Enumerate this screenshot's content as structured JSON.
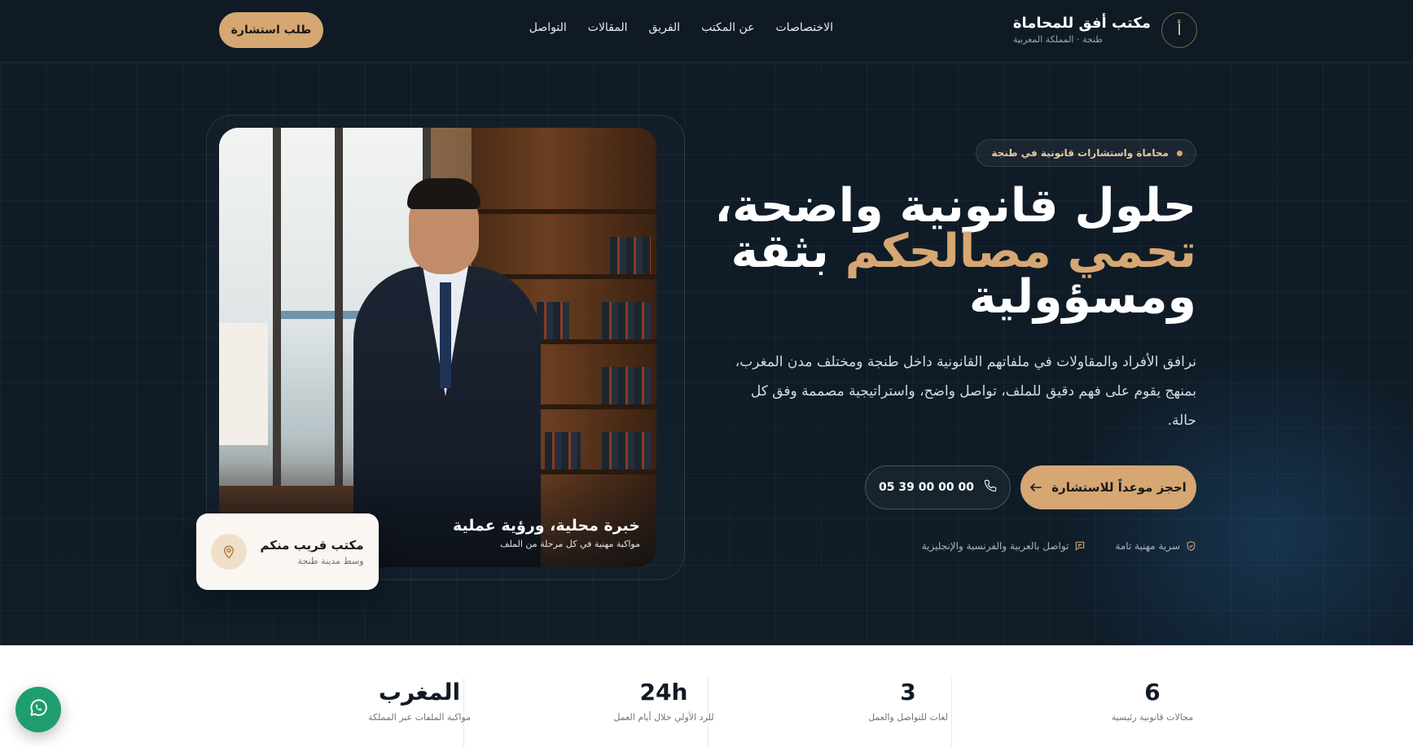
{
  "header": {
    "logo_badge": "أ",
    "brand_title": "مكتب أفق للمحاماة",
    "brand_subtitle": "طنجة · المملكة المغربية",
    "nav": [
      "الاختصاصات",
      "عن المكتب",
      "الفريق",
      "المقالات",
      "التواصل"
    ],
    "cta_label": "طلب استشارة"
  },
  "hero": {
    "pill_label": "محاماة واستشارات قانونية في طنجة",
    "headline_line1": "حلول قانونية واضحة،",
    "headline_accent": "تحمي مصالحكم",
    "headline_rest": " بثقة",
    "headline_line3": "ومسؤولية",
    "paragraph": "نرافق الأفراد والمقاولات في ملفاتهم القانونية داخل طنجة ومختلف مدن المغرب، بمنهج يقوم على فهم دقيق للملف، تواصل واضح، واستراتيجية مصممة وفق كل حالة.",
    "primary_cta": "احجز موعداً للاستشارة",
    "phone_number": "05 39 00 00 00",
    "trust": {
      "confidentiality": "سرية مهنية تامة",
      "languages": "تواصل بالعربية والفرنسية والإنجليزية"
    },
    "photo_caption_title": "خبرة محلية، ورؤية عملية",
    "photo_caption_subtitle": "مواكبة مهنية في كل مرحلة من الملف",
    "office_card_title": "مكتب قريب منكم",
    "office_card_subtitle": "وسط مدينة طنجة"
  },
  "stats": [
    {
      "value": "6",
      "label": "مجالات قانونية رئيسية"
    },
    {
      "value": "3",
      "label": "لغات للتواصل والعمل"
    },
    {
      "value": "24h",
      "label": "للرد الأولي خلال أيام العمل"
    },
    {
      "value": "المغرب",
      "label": "مواكبة الملفات عبر المملكة"
    }
  ],
  "colors": {
    "background": "#0f1b26",
    "accent": "#d6a772",
    "whatsapp": "#1f9d6e"
  },
  "icons": {
    "phone": "phone-icon",
    "arrow": "arrow-left-icon",
    "shield": "shield-icon",
    "chat": "chat-icon",
    "location": "location-pin-icon",
    "whatsapp": "whatsapp-icon"
  }
}
